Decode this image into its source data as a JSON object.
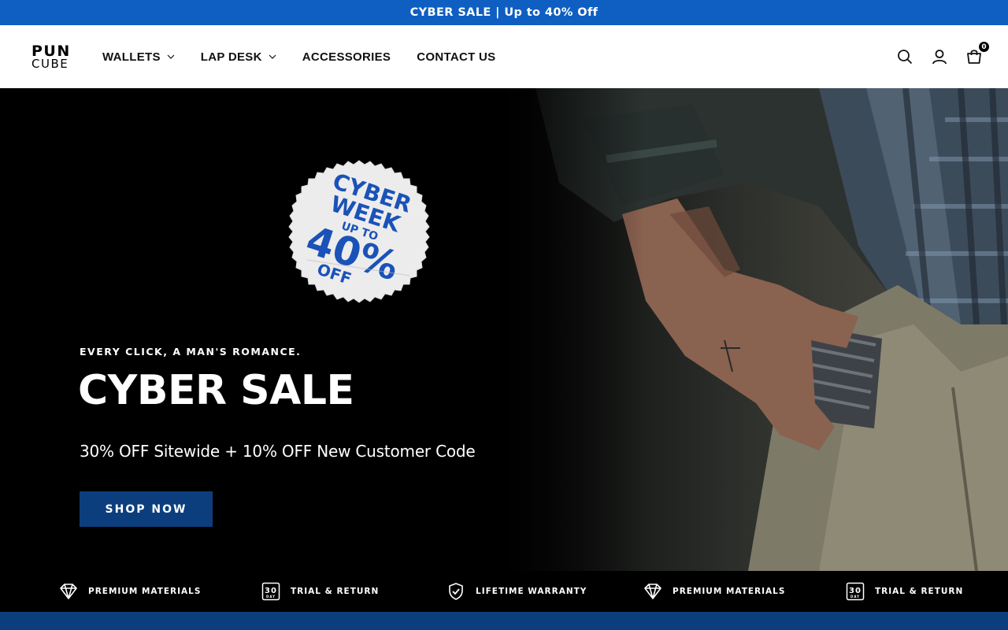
{
  "announcement": {
    "text": "CYBER SALE | Up to 40% Off"
  },
  "header": {
    "logo": {
      "line1": "PUN",
      "line2": "CUBE"
    },
    "nav": [
      {
        "label": "WALLETS",
        "has_dropdown": true
      },
      {
        "label": "LAP DESK",
        "has_dropdown": true
      },
      {
        "label": "ACCESSORIES",
        "has_dropdown": false
      },
      {
        "label": "CONTACT US",
        "has_dropdown": false
      }
    ],
    "icons": [
      "search-icon",
      "account-icon",
      "cart-icon"
    ],
    "cart_count": "0"
  },
  "hero": {
    "badge": {
      "line1": "CYBER",
      "line2": "WEEK",
      "line3": "UP TO",
      "line4": "40%",
      "line5": "OFF"
    },
    "eyebrow": "EVERY CLICK, A MAN'S ROMANCE.",
    "title": "CYBER SALE",
    "subtitle": "30% OFF Sitewide + 10% OFF New Customer Code",
    "cta": "SHOP NOW"
  },
  "features": [
    {
      "icon": "diamond-icon",
      "label": "PREMIUM MATERIALS"
    },
    {
      "icon": "30-day-icon",
      "label": "TRIAL & RETURN"
    },
    {
      "icon": "shield-check-icon",
      "label": "LIFETIME WARRANTY"
    },
    {
      "icon": "diamond-icon",
      "label": "PREMIUM MATERIALS"
    },
    {
      "icon": "30-day-icon",
      "label": "TRIAL & RETURN"
    }
  ],
  "colors": {
    "announcement_bg": "#0e5fc1",
    "cta_bg": "#0c3e7e",
    "badge_text": "#1a52b8"
  }
}
